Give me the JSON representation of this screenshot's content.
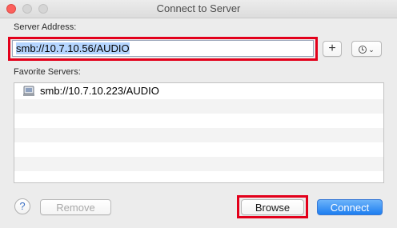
{
  "window": {
    "title": "Connect to Server"
  },
  "server_address": {
    "label": "Server Address:",
    "value": "smb://10.7.10.56/AUDIO"
  },
  "toolbar": {
    "add_label": "+",
    "recent_icon": "clock-icon",
    "recent_chevron": "⌄"
  },
  "favorites": {
    "label": "Favorite Servers:",
    "items": [
      "smb://10.7.10.223/AUDIO",
      "",
      "",
      "",
      "",
      "",
      ""
    ]
  },
  "footer": {
    "help_label": "?",
    "remove_label": "Remove",
    "browse_label": "Browse",
    "connect_label": "Connect"
  },
  "colors": {
    "accent": "#1d7ef0",
    "highlight": "#e3001b",
    "close_button": "#fc605c"
  }
}
